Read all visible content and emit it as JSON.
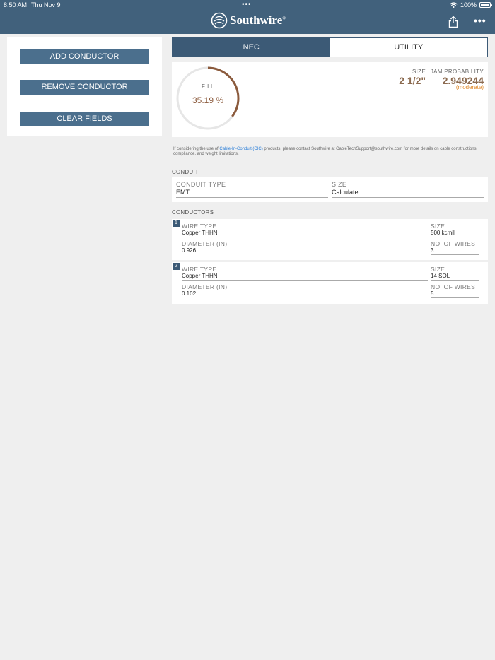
{
  "status_bar": {
    "time": "8:50 AM",
    "date": "Thu Nov 9",
    "battery": "100%",
    "battery_level": 1.0
  },
  "header": {
    "brand": "Southwire",
    "brand_mark": "®",
    "share_icon": "share-icon",
    "more_icon": "more-icon"
  },
  "actions": {
    "add": "ADD CONDUCTOR",
    "remove": "REMOVE CONDUCTOR",
    "clear": "CLEAR FIELDS"
  },
  "tabs": [
    {
      "label": "NEC",
      "active": true
    },
    {
      "label": "UTILITY",
      "active": false
    }
  ],
  "results": {
    "fill_label": "FILL",
    "fill_value": "35.19 %",
    "fill_fraction": 0.3519,
    "size_label": "SIZE",
    "size_value": "2 1/2\"",
    "jam_label": "JAM PROBABILITY",
    "jam_value": "2.949244",
    "jam_note": "(moderate)"
  },
  "notice": {
    "before": "If considering the use of ",
    "link": "Cable-In-Conduit (CIC)",
    "after": " products, please contact Southwire at CableTechSupport@southwire.com for more details on cable constructions, compliance, and weight limitations."
  },
  "conduit": {
    "section_title": "CONDUIT",
    "type_label": "CONDUIT TYPE",
    "type_value": "EMT",
    "size_label": "SIZE",
    "size_value": "Calculate"
  },
  "conductors": {
    "section_title": "CONDUCTORS",
    "items": [
      {
        "index": "1",
        "wire_type_label": "WIRE TYPE",
        "wire_type": "Copper THHN",
        "size_label": "SIZE",
        "size": "500 kcmil",
        "diameter_label": "DIAMETER (IN)",
        "diameter": "0.926",
        "wires_label": "NO. OF WIRES",
        "wires": "3"
      },
      {
        "index": "2",
        "wire_type_label": "WIRE TYPE",
        "wire_type": "Copper THHN",
        "size_label": "SIZE",
        "size": "14 SOL",
        "diameter_label": "DIAMETER (IN)",
        "diameter": "0.102",
        "wires_label": "NO. OF WIRES",
        "wires": "5"
      }
    ]
  },
  "colors": {
    "header": "#41617c",
    "button": "#4b6f8d",
    "gauge_fill": "#8b5a3c",
    "jam_note": "#e08a2c",
    "link": "#2f80d8"
  }
}
